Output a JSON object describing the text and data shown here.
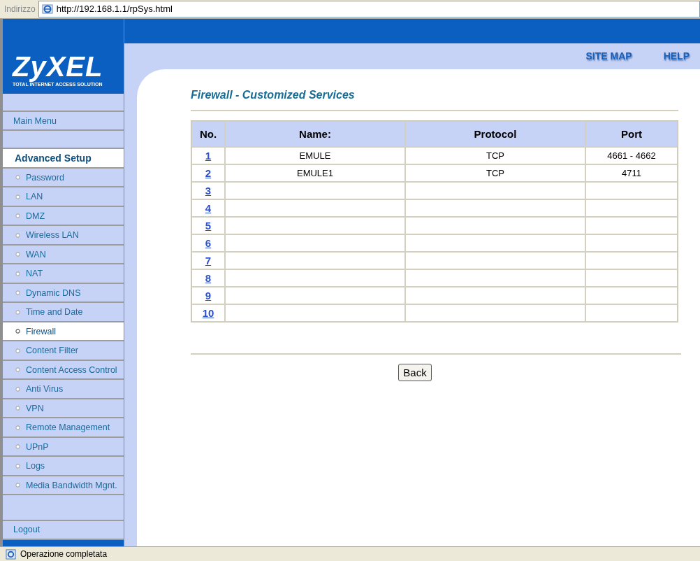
{
  "address_bar": {
    "label": "Indirizzo",
    "url": "http://192.168.1.1/rpSys.html"
  },
  "logo": {
    "name": "ZyXEL",
    "tagline": "TOTAL INTERNET ACCESS SOLUTION"
  },
  "header_links": [
    "SITE MAP",
    "HELP"
  ],
  "sidebar": {
    "main_menu": "Main Menu",
    "section": "Advanced Setup",
    "items": [
      {
        "label": "Password",
        "selected": false
      },
      {
        "label": "LAN",
        "selected": false
      },
      {
        "label": "DMZ",
        "selected": false
      },
      {
        "label": "Wireless LAN",
        "selected": false
      },
      {
        "label": "WAN",
        "selected": false
      },
      {
        "label": "NAT",
        "selected": false
      },
      {
        "label": "Dynamic DNS",
        "selected": false
      },
      {
        "label": "Time and Date",
        "selected": false
      },
      {
        "label": "Firewall",
        "selected": true
      },
      {
        "label": "Content Filter",
        "selected": false
      },
      {
        "label": "Content Access Control",
        "selected": false
      },
      {
        "label": "Anti Virus",
        "selected": false
      },
      {
        "label": "VPN",
        "selected": false
      },
      {
        "label": "Remote Management",
        "selected": false
      },
      {
        "label": "UPnP",
        "selected": false
      },
      {
        "label": "Logs",
        "selected": false
      },
      {
        "label": "Media Bandwidth Mgnt.",
        "selected": false
      }
    ],
    "logout": "Logout"
  },
  "page_title": "Firewall - Customized Services",
  "table": {
    "columns": [
      "No.",
      "Name:",
      "Protocol",
      "Port"
    ],
    "rows": [
      {
        "no": "1",
        "name": "EMULE",
        "protocol": "TCP",
        "port": "4661 - 4662"
      },
      {
        "no": "2",
        "name": "EMULE1",
        "protocol": "TCP",
        "port": "4711"
      },
      {
        "no": "3",
        "name": "",
        "protocol": "",
        "port": ""
      },
      {
        "no": "4",
        "name": "",
        "protocol": "",
        "port": ""
      },
      {
        "no": "5",
        "name": "",
        "protocol": "",
        "port": ""
      },
      {
        "no": "6",
        "name": "",
        "protocol": "",
        "port": ""
      },
      {
        "no": "7",
        "name": "",
        "protocol": "",
        "port": ""
      },
      {
        "no": "8",
        "name": "",
        "protocol": "",
        "port": ""
      },
      {
        "no": "9",
        "name": "",
        "protocol": "",
        "port": ""
      },
      {
        "no": "10",
        "name": "",
        "protocol": "",
        "port": ""
      }
    ]
  },
  "buttons": [
    "Back"
  ],
  "status_bar": {
    "text": "Operazione completata"
  }
}
